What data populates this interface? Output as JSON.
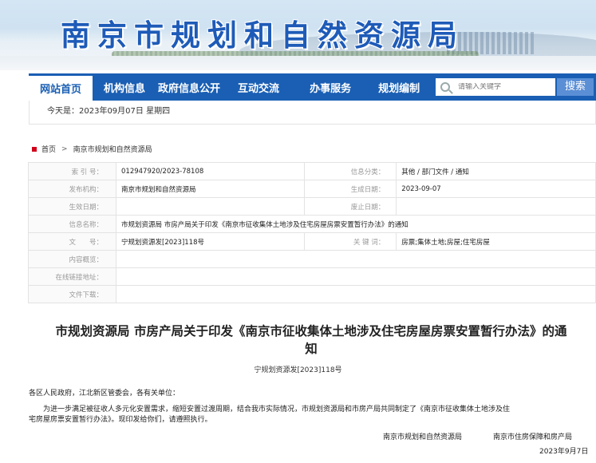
{
  "header": {
    "title": "南京市规划和自然资源局"
  },
  "nav": {
    "items": [
      "网站首页",
      "机构信息",
      "政府信息公开",
      "互动交流",
      "办事服务",
      "规划编制"
    ],
    "search_placeholder": "请输入关键字",
    "search_button": "搜索"
  },
  "date_line": "今天是：2023年09月07日 星期四",
  "breadcrumb": {
    "home": "首页",
    "sep": ">",
    "current": "南京市规划和自然资源局"
  },
  "meta": {
    "index_label": "索 引 号：",
    "index_value": "012947920/2023-78108",
    "category_label": "信息分类：",
    "category_value": "其他 / 部门文件 / 通知",
    "publisher_label": "发布机构：",
    "publisher_value": "南京市规划和自然资源局",
    "created_label": "生成日期：",
    "created_value": "2023-09-07",
    "effective_label": "生效日期：",
    "effective_value": "",
    "abolish_label": "废止日期：",
    "abolish_value": "",
    "name_label": "信息名称：",
    "name_value": "市规划资源局 市房产局关于印发《南京市征收集体土地涉及住宅房屋房票安置暂行办法》的通知",
    "docno_label": "文　　号：",
    "docno_value": "宁规划资源发[2023]118号",
    "keywords_label": "关 键 词：",
    "keywords_value": "房票;集体土地;房屋;住宅房屋",
    "summary_label": "内容概览：",
    "summary_value": "",
    "link_label": "在线链接地址：",
    "link_value": "",
    "download_label": "文件下载：",
    "download_value": ""
  },
  "article": {
    "title_line1": "市规划资源局 市房产局关于印发《南京市征收集体土地涉及住宅房屋房票安置暂行办法》的通",
    "title_line2": "知",
    "doc_number": "宁规划资源发[2023]118号",
    "salutation": "各区人民政府，江北新区管委会，各有关单位：",
    "para1_line1": "为进一步满足被征收人多元化安置需求，缩短安置过渡周期，结合我市实际情况，市规划资源局和市房产局共同制定了《南京市征收集体土地涉及住",
    "para1_line2": "宅房屋房票安置暂行办法》。现印发给你们，请遵照执行。",
    "sign_org1": "南京市规划和自然资源局",
    "sign_org2": "南京市住房保障和房产局",
    "sign_date": "2023年9月7日"
  }
}
